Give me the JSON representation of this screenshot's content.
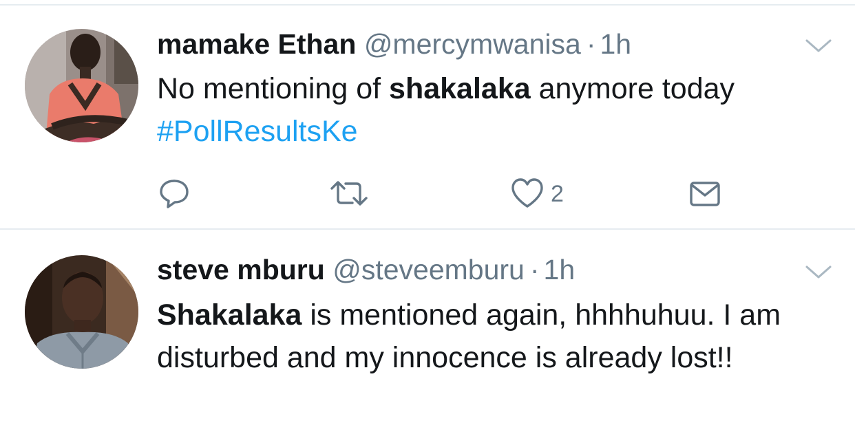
{
  "tweets": [
    {
      "author_name": "mamake Ethan",
      "handle": "@mercymwanisa",
      "separator": "·",
      "time": "1h",
      "text_parts": [
        "No mentioning of ",
        "shakalaka",
        " anymore today ",
        "#PollResultsKe"
      ],
      "avatar_icon": "avatar-woman-photo",
      "actions": {
        "reply_icon": "reply-icon",
        "retweet_icon": "retweet-icon",
        "like_icon": "heart-icon",
        "like_count": "2",
        "dm_icon": "envelope-icon"
      },
      "menu_icon": "chevron-down-icon"
    },
    {
      "author_name": "steve mburu",
      "handle": "@steveemburu",
      "separator": "·",
      "time": "1h",
      "text_parts": [
        "Shakalaka",
        " is mentioned again, hhhhuhuu. I am disturbed and my innocence is already lost!!"
      ],
      "avatar_icon": "avatar-man-photo",
      "menu_icon": "chevron-down-icon"
    }
  ],
  "colors": {
    "text": "#14171a",
    "secondary": "#657786",
    "link": "#1da1f2",
    "divider": "#e6ecf0"
  }
}
